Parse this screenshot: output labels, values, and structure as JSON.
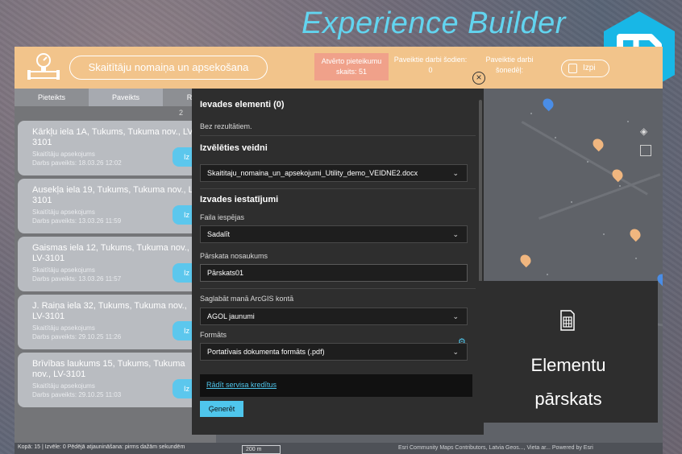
{
  "header": {
    "product_title": "Experience Builder"
  },
  "app": {
    "title": "Skaitītāju nomaiņa un apsekošana",
    "stats": {
      "open": "Atvērto pieteikumu skaits: 51",
      "today": "Paveiktie darbi šodien: 0",
      "week": "Paveiktie darbi šonedēļ:"
    },
    "export_label": "Izpi"
  },
  "list": {
    "tabs": [
      "Pieteikts",
      "Paveikts",
      "R"
    ],
    "count": "2",
    "items": [
      {
        "address": "Kārkļu iela 1A, Tukums, Tukuma nov., LV-3101",
        "type": "Skaitītāju apsekojums",
        "done": "Darbs paveikts: 18.03.26 12:02",
        "button": "Iz"
      },
      {
        "address": "Ausekļa iela 19, Tukums, Tukuma nov., LV-3101",
        "type": "Skaitītāju apsekojums",
        "done": "Darbs paveikts: 13.03.26 11:59",
        "button": "Iz"
      },
      {
        "address": "Gaismas iela 12, Tukums, Tukuma nov., LV-3101",
        "type": "Skaitītāju apsekojums",
        "done": "Darbs paveikts: 13.03.26 11:57",
        "button": "Iz"
      },
      {
        "address": "J. Raiņa iela 32, Tukums, Tukuma nov., LV-3101",
        "type": "Skaitītāju apsekojums",
        "done": "Darbs paveikts: 29.10.25 11:26",
        "button": "Iz"
      },
      {
        "address": "Brīvības laukums 15, Tukums, Tukuma nov., LV-3101",
        "type": "Skaitītāju apsekojums",
        "done": "Darbs paveikts: 29.10.25 11:03",
        "button": "Iz"
      }
    ]
  },
  "status": {
    "text": "Kopā: 15 | Izvēle: 0    Pēdējā atjaunināšana: pirms dažām sekundēm",
    "scale": "200 m",
    "attribution": "Esri Community Maps Contributors, Latvia Geos..., Vieta ar... Powered by Esri"
  },
  "dialog": {
    "input_heading": "Ievades elementi (0)",
    "no_results": "Bez rezultātiem.",
    "template_heading": "Izvēlēties veidni",
    "template_value": "Skaititaju_nomaina_un_apsekojumi_Utility_demo_VEIDNE2.docx",
    "output_heading": "Izvades iestatījumi",
    "file_options_label": "Faila iespējas",
    "file_options_value": "Sadalīt",
    "report_name_label": "Pārskata nosaukums",
    "report_name_value": "Pārskats01",
    "save_label": "Saglabāt manā ArcGIS kontā",
    "save_value": "AGOL jaunumi",
    "format_label": "Formāts",
    "format_value": "Portatīvais dokumenta formāts (.pdf)",
    "credits_link": "Rādīt servisa kredītus",
    "generate_button": "Ģenerēt"
  },
  "callout": {
    "line1": "Elementu",
    "line2": "pārskats"
  },
  "colors": {
    "accent": "#4fc6ec",
    "topbar": "#f2c48b",
    "title": "#62d4ef"
  },
  "icons": [
    "experience-builder-logo-icon",
    "meter-icon",
    "close-icon",
    "export-icon",
    "gear-icon",
    "layers-icon",
    "basemap-gallery-icon",
    "report-icon",
    "chevron-down-icon"
  ]
}
